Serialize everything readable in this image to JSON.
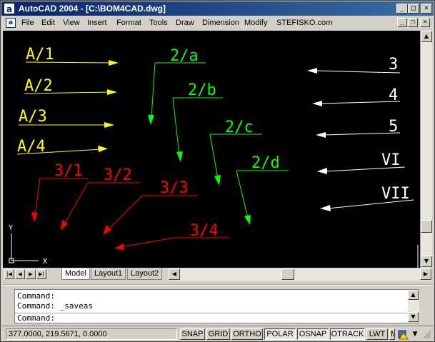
{
  "window": {
    "app_icon": "a",
    "title": "AutoCAD 2004 - [C:\\BOM4CAD.dwg]",
    "minimize_glyph": "_",
    "maximize_glyph": "□",
    "close_glyph": "×"
  },
  "menubar": {
    "doc_icon": "a",
    "items": [
      "File",
      "Edit",
      "View",
      "Insert",
      "Format",
      "Tools",
      "Draw",
      "Dimension",
      "Modify",
      "STEFISKO.com"
    ],
    "doc_minimize_glyph": "_",
    "doc_restore_glyph": "❐",
    "doc_close_glyph": "×"
  },
  "drawing": {
    "yellow_labels": [
      "A/1",
      "A/2",
      "A/3",
      "A/4"
    ],
    "green_labels": [
      "2/a",
      "2/b",
      "2/c",
      "2/d"
    ],
    "red_labels": [
      "3/1",
      "3/2",
      "3/3",
      "3/4"
    ],
    "white_labels": [
      "3",
      "4",
      "5",
      "VI",
      "VII"
    ],
    "ucs_x": "X",
    "ucs_y": "Y",
    "colors": {
      "yellow": "#ffff00",
      "green": "#00ff00",
      "red": "#ff0000",
      "white": "#ffffff",
      "background": "#000000"
    }
  },
  "tabs": {
    "nav_first": "first-tab",
    "items": [
      "Model",
      "Layout1",
      "Layout2"
    ],
    "active": "Model"
  },
  "command": {
    "lines": [
      "Command:",
      "Command: _saveas"
    ],
    "prompt": "Command:"
  },
  "status": {
    "coords": "377.0000, 219.5671, 0.0000",
    "buttons": [
      "SNAP",
      "GRID",
      "ORTHO",
      "POLAR",
      "OSNAP",
      "OTRACK",
      "LWT",
      "MODEL"
    ],
    "on_buttons": [
      "POLAR",
      "OSNAP",
      "OTRACK"
    ]
  }
}
